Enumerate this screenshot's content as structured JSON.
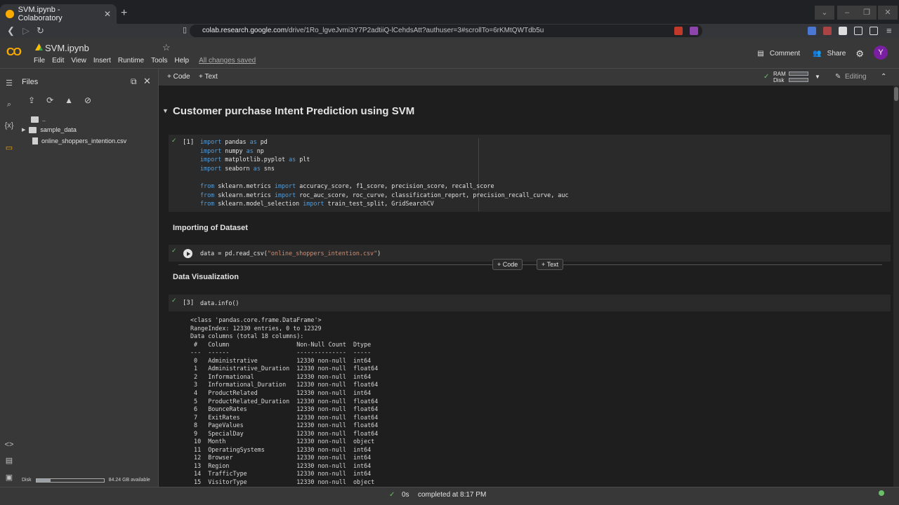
{
  "browser": {
    "tab_title": "SVM.ipynb - Colaboratory",
    "tab_close": "✕",
    "new_tab": "+",
    "url_host": "colab.research.google.com",
    "url_path": "/drive/1Ro_lgveJvmi3Y7P2adtiiQ-lCehdsAtt?authuser=3#scrollTo=6rKMtQWTdb5u"
  },
  "header": {
    "logo": "CO",
    "notebook_title": "SVM.ipynb",
    "menu": [
      "File",
      "Edit",
      "View",
      "Insert",
      "Runtime",
      "Tools",
      "Help"
    ],
    "save_status": "All changes saved",
    "comment_label": "Comment",
    "share_label": "Share",
    "avatar_letter": "Y"
  },
  "files_panel": {
    "title": "Files",
    "parent_dir": "..",
    "folder": "sample_data",
    "file": "online_shoppers_intention.csv",
    "disk_label": "Disk",
    "disk_available": "84.24 GB available",
    "disk_used_fraction": 0.21
  },
  "toolbar": {
    "add_code": "+ Code",
    "add_text": "+ Text",
    "ram_label": "RAM",
    "disk_label": "Disk",
    "editing_label": "Editing"
  },
  "notebook": {
    "title_heading": "Customer purchase Intent Prediction using SVM",
    "cell1_prompt": "[1]",
    "cell1_lines": [
      "import pandas as pd",
      "import numpy as np",
      "import matplotlib.pyplot as plt",
      "import seaborn as sns",
      "",
      "from sklearn.metrics import accuracy_score, f1_score, precision_score, recall_score",
      "from sklearn.metrics import roc_auc_score, roc_curve, classification_report, precision_recall_curve, auc",
      "from sklearn.model_selection import train_test_split, GridSearchCV"
    ],
    "section_import": "Importing of Dataset",
    "cell2_code": "data = pd.read_csv(\"online_shoppers_intention.csv\")",
    "insert_code": "+ Code",
    "insert_text": "+ Text",
    "section_viz": "Data Visualization",
    "cell3_prompt": "[3]",
    "cell3_code": "data.info()",
    "output_lines": [
      "<class 'pandas.core.frame.DataFrame'>",
      "RangeIndex: 12330 entries, 0 to 12329",
      "Data columns (total 18 columns):",
      " #   Column                   Non-Null Count  Dtype  ",
      "---  ------                   --------------  -----  ",
      " 0   Administrative           12330 non-null  int64  ",
      " 1   Administrative_Duration  12330 non-null  float64",
      " 2   Informational            12330 non-null  int64  ",
      " 3   Informational_Duration   12330 non-null  float64",
      " 4   ProductRelated           12330 non-null  int64  ",
      " 5   ProductRelated_Duration  12330 non-null  float64",
      " 6   BounceRates              12330 non-null  float64",
      " 7   ExitRates                12330 non-null  float64",
      " 8   PageValues               12330 non-null  float64",
      " 9   SpecialDay               12330 non-null  float64",
      " 10  Month                    12330 non-null  object ",
      " 11  OperatingSystems         12330 non-null  int64  ",
      " 12  Browser                  12330 non-null  int64  ",
      " 13  Region                   12330 non-null  int64  ",
      " 14  TrafficType              12330 non-null  int64  ",
      " 15  VisitorType              12330 non-null  object "
    ]
  },
  "status": {
    "check": "✓",
    "time": "0s",
    "completed": "completed at 8:17 PM"
  }
}
